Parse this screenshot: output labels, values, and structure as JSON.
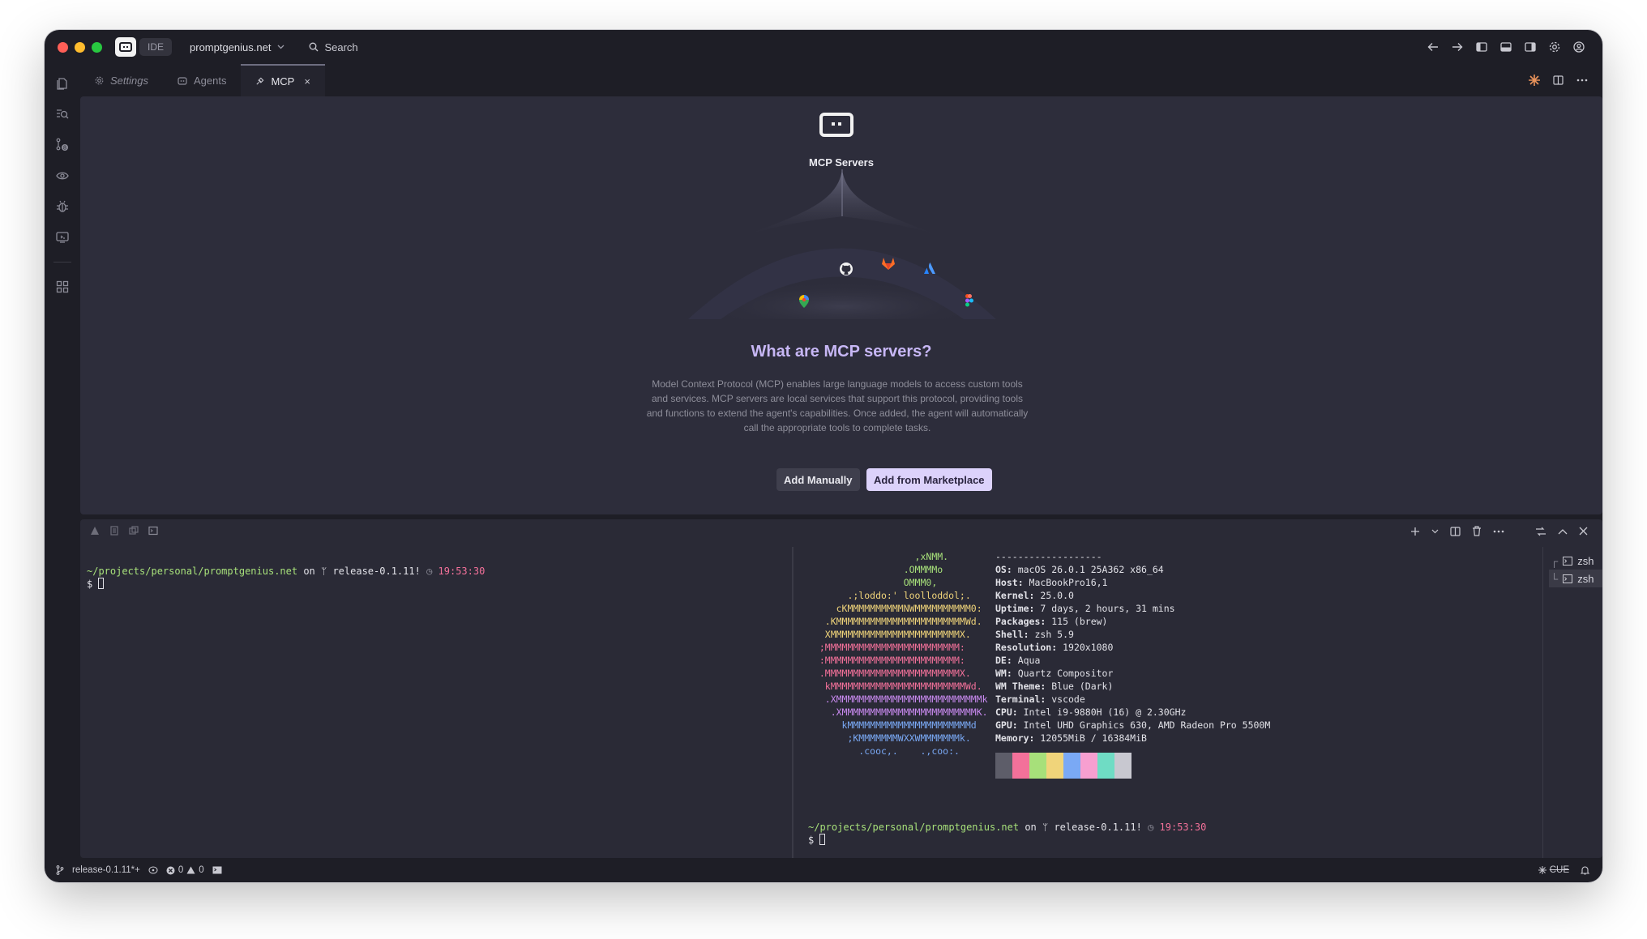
{
  "titlebar": {
    "ide_label": "IDE",
    "project_name": "promptgenius.net",
    "search_label": "Search"
  },
  "tabs": [
    {
      "label": "Settings"
    },
    {
      "label": "Agents"
    },
    {
      "label": "MCP",
      "close": "×"
    }
  ],
  "mcp": {
    "hero_title": "MCP Servers",
    "question": "What are MCP servers?",
    "description": "Model Context Protocol (MCP) enables large language models to access custom tools and services. MCP servers are local services that support this protocol, providing tools and functions to extend the agent's capabilities. Once added, the agent will automatically call the appropriate tools to complete tasks.",
    "add_manually": "Add Manually",
    "add_marketplace": "Add from Marketplace",
    "service_icons": [
      "google-maps-icon",
      "github-icon",
      "gitlab-icon",
      "atlassian-icon",
      "figma-icon"
    ]
  },
  "terminal": {
    "path": "~/projects/personal/promptgenius.net",
    "on": "on",
    "branch": "release-0.1.11!",
    "time": "19:53:30",
    "dollar": "$",
    "ascii_lines": [
      "                   ,xNMM.",
      "                 .OMMMMo",
      "                 OMMM0,",
      "       .;loddo:' loolloddol;.",
      "     cKMMMMMMMMMMNWMMMMMMMMMM0:",
      "   .KMMMMMMMMMMMMMMMMMMMMMMMWd.",
      "   XMMMMMMMMMMMMMMMMMMMMMMMX.",
      "  ;MMMMMMMMMMMMMMMMMMMMMMMM:",
      "  :MMMMMMMMMMMMMMMMMMMMMMMM:",
      "  .MMMMMMMMMMMMMMMMMMMMMMMMX.",
      "   kMMMMMMMMMMMMMMMMMMMMMMMMWd.",
      "   .XMMMMMMMMMMMMMMMMMMMMMMMMMMk",
      "    .XMMMMMMMMMMMMMMMMMMMMMMMMK.",
      "      kMMMMMMMMMMMMMMMMMMMMMMd",
      "       ;KMMMMMMMWXXWMMMMMMMk.",
      "         .cooc,.    .,coo:."
    ],
    "ascii_colors": [
      "#a7e07a",
      "#a7e07a",
      "#a7e07a",
      "#f0d47a",
      "#f0d47a",
      "#f0d47a",
      "#f0d47a",
      "#f3719a",
      "#f3719a",
      "#f3719a",
      "#f3719a",
      "#c98af0",
      "#c98af0",
      "#7aa9f5",
      "#7aa9f5",
      "#7aa9f5"
    ],
    "separator": "-------------------",
    "info": [
      {
        "key": "OS:",
        "value": "macOS 26.0.1 25A362 x86_64"
      },
      {
        "key": "Host:",
        "value": "MacBookPro16,1"
      },
      {
        "key": "Kernel:",
        "value": "25.0.0"
      },
      {
        "key": "Uptime:",
        "value": "7 days, 2 hours, 31 mins"
      },
      {
        "key": "Packages:",
        "value": "115 (brew)"
      },
      {
        "key": "Shell:",
        "value": "zsh 5.9"
      },
      {
        "key": "Resolution:",
        "value": "1920x1080"
      },
      {
        "key": "DE:",
        "value": "Aqua"
      },
      {
        "key": "WM:",
        "value": "Quartz Compositor"
      },
      {
        "key": "WM Theme:",
        "value": "Blue (Dark)"
      },
      {
        "key": "Terminal:",
        "value": "vscode"
      },
      {
        "key": "CPU:",
        "value": "Intel i9-9880H (16) @ 2.30GHz"
      },
      {
        "key": "GPU:",
        "value": "Intel UHD Graphics 630, AMD Radeon Pro 5500M"
      },
      {
        "key": "Memory:",
        "value": "12055MiB / 16384MiB"
      }
    ],
    "swatch_colors": [
      "#5d5d69",
      "#f3719a",
      "#a7e07a",
      "#f0d47a",
      "#7aa9f5",
      "#f79fd0",
      "#6fdcc4",
      "#c8c8d0"
    ],
    "sessions": [
      {
        "label": "zsh"
      },
      {
        "label": "zsh"
      }
    ]
  },
  "status": {
    "branch": "release-0.1.11*+",
    "errors": "0",
    "warnings": "0",
    "right_label": "CUE"
  },
  "colors": {
    "accent": "#c7b7f5",
    "prompt_green": "#a7e07a",
    "prompt_pink": "#f3719a"
  }
}
